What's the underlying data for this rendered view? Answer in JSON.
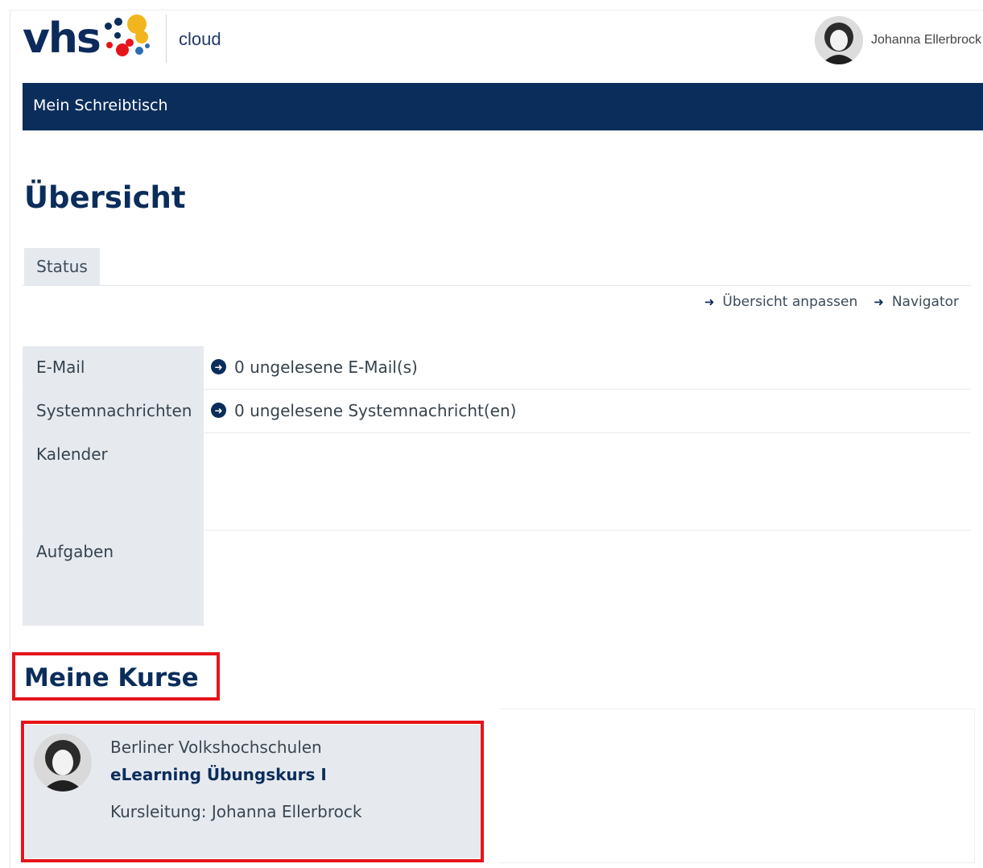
{
  "header": {
    "logo_text": "vhs",
    "app_name": "cloud",
    "user_name": "Johanna Ellerbrock"
  },
  "nav": {
    "desk_label": "Mein Schreibtisch"
  },
  "page": {
    "title": "Übersicht"
  },
  "tabs": [
    {
      "label": "Status"
    }
  ],
  "actions": [
    {
      "label": "Übersicht anpassen"
    },
    {
      "label": "Navigator"
    }
  ],
  "status": {
    "rows": [
      {
        "label": "E-Mail",
        "value": "0 ungelesene E-Mail(s)"
      },
      {
        "label": "Systemnachrichten",
        "value": "0 ungelesene Systemnachricht(en)"
      },
      {
        "label": "Kalender",
        "value": ""
      },
      {
        "label": "Aufgaben",
        "value": ""
      }
    ]
  },
  "courses": {
    "title": "Meine Kurse",
    "items": [
      {
        "org": "Berliner Volkshochschulen",
        "title": "eLearning Übungskurs I",
        "lead": "Kursleitung: Johanna Ellerbrock"
      }
    ]
  },
  "colors": {
    "brand_navy": "#0b2d5b",
    "highlight_red": "#e5141b",
    "panel_grey": "#e6eaef"
  }
}
